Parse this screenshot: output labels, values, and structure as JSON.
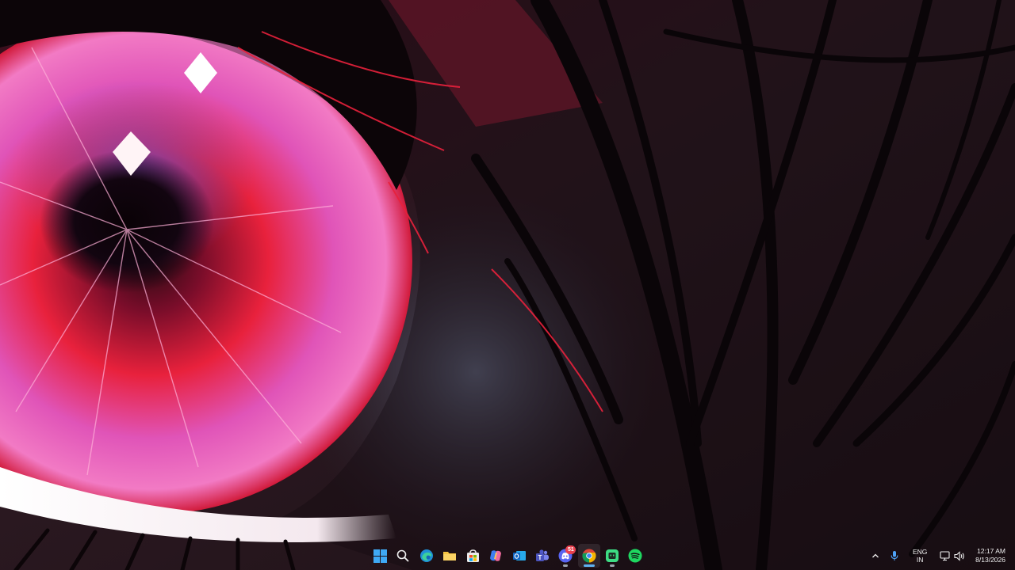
{
  "taskbar": {
    "pinned": [
      {
        "name": "start-button",
        "icon": "windows-start-icon",
        "active": false
      },
      {
        "name": "search-button",
        "icon": "search-icon",
        "active": false
      },
      {
        "name": "edge-button",
        "icon": "edge-icon",
        "active": false
      },
      {
        "name": "file-explorer-button",
        "icon": "folder-icon",
        "active": false
      },
      {
        "name": "microsoft-store-button",
        "icon": "store-icon",
        "active": false
      },
      {
        "name": "copilot-button",
        "icon": "copilot-icon",
        "active": false
      },
      {
        "name": "outlook-button",
        "icon": "outlook-icon",
        "active": false
      },
      {
        "name": "teams-button",
        "icon": "teams-icon",
        "active": false
      },
      {
        "name": "discord-button",
        "icon": "discord-icon",
        "active": false,
        "badge": "51"
      },
      {
        "name": "chrome-button",
        "icon": "chrome-icon",
        "active": true
      },
      {
        "name": "green-app-button",
        "icon": "app-icon",
        "active": false
      },
      {
        "name": "spotify-button",
        "icon": "spotify-icon",
        "active": false
      }
    ]
  },
  "tray": {
    "language_line1": "ENG",
    "language_line2": "IN",
    "time": "12:17 AM",
    "date": "8/13/2026",
    "icons": [
      "chevron-up-icon",
      "microphone-icon",
      "network-icon",
      "volume-icon"
    ]
  },
  "colors": {
    "wallpaper_dark": "#140b10",
    "accent_red": "#e8213c",
    "accent_pink": "#e054b8",
    "active_indicator": "#5fb2f2"
  }
}
